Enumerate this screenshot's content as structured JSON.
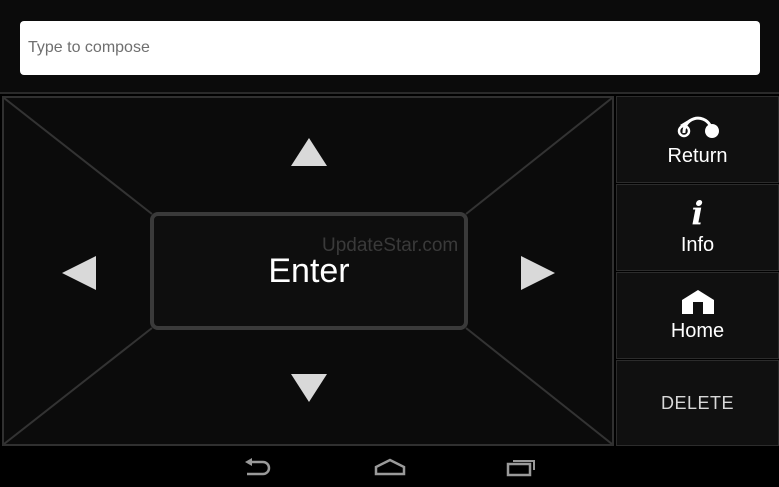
{
  "compose": {
    "placeholder": "Type to compose",
    "value": ""
  },
  "dpad": {
    "enter_label": "Enter",
    "watermark": "UpdateStar.com",
    "arrow_icons": {
      "up": "triangle-up-icon",
      "down": "triangle-down-icon",
      "left": "triangle-left-icon",
      "right": "triangle-right-icon"
    }
  },
  "side_buttons": {
    "return_label": "Return",
    "info_label": "Info",
    "info_glyph": "i",
    "home_label": "Home",
    "delete_label": "DELETE"
  },
  "nav_bar": {
    "icons": [
      "back-icon",
      "home-icon",
      "recent-apps-icon"
    ]
  },
  "colors": {
    "background": "#000000",
    "panel": "#0b0b0b",
    "border": "#303030",
    "text": "#ffffff",
    "arrow": "#d9d9d9",
    "input_bg": "#ffffff"
  }
}
